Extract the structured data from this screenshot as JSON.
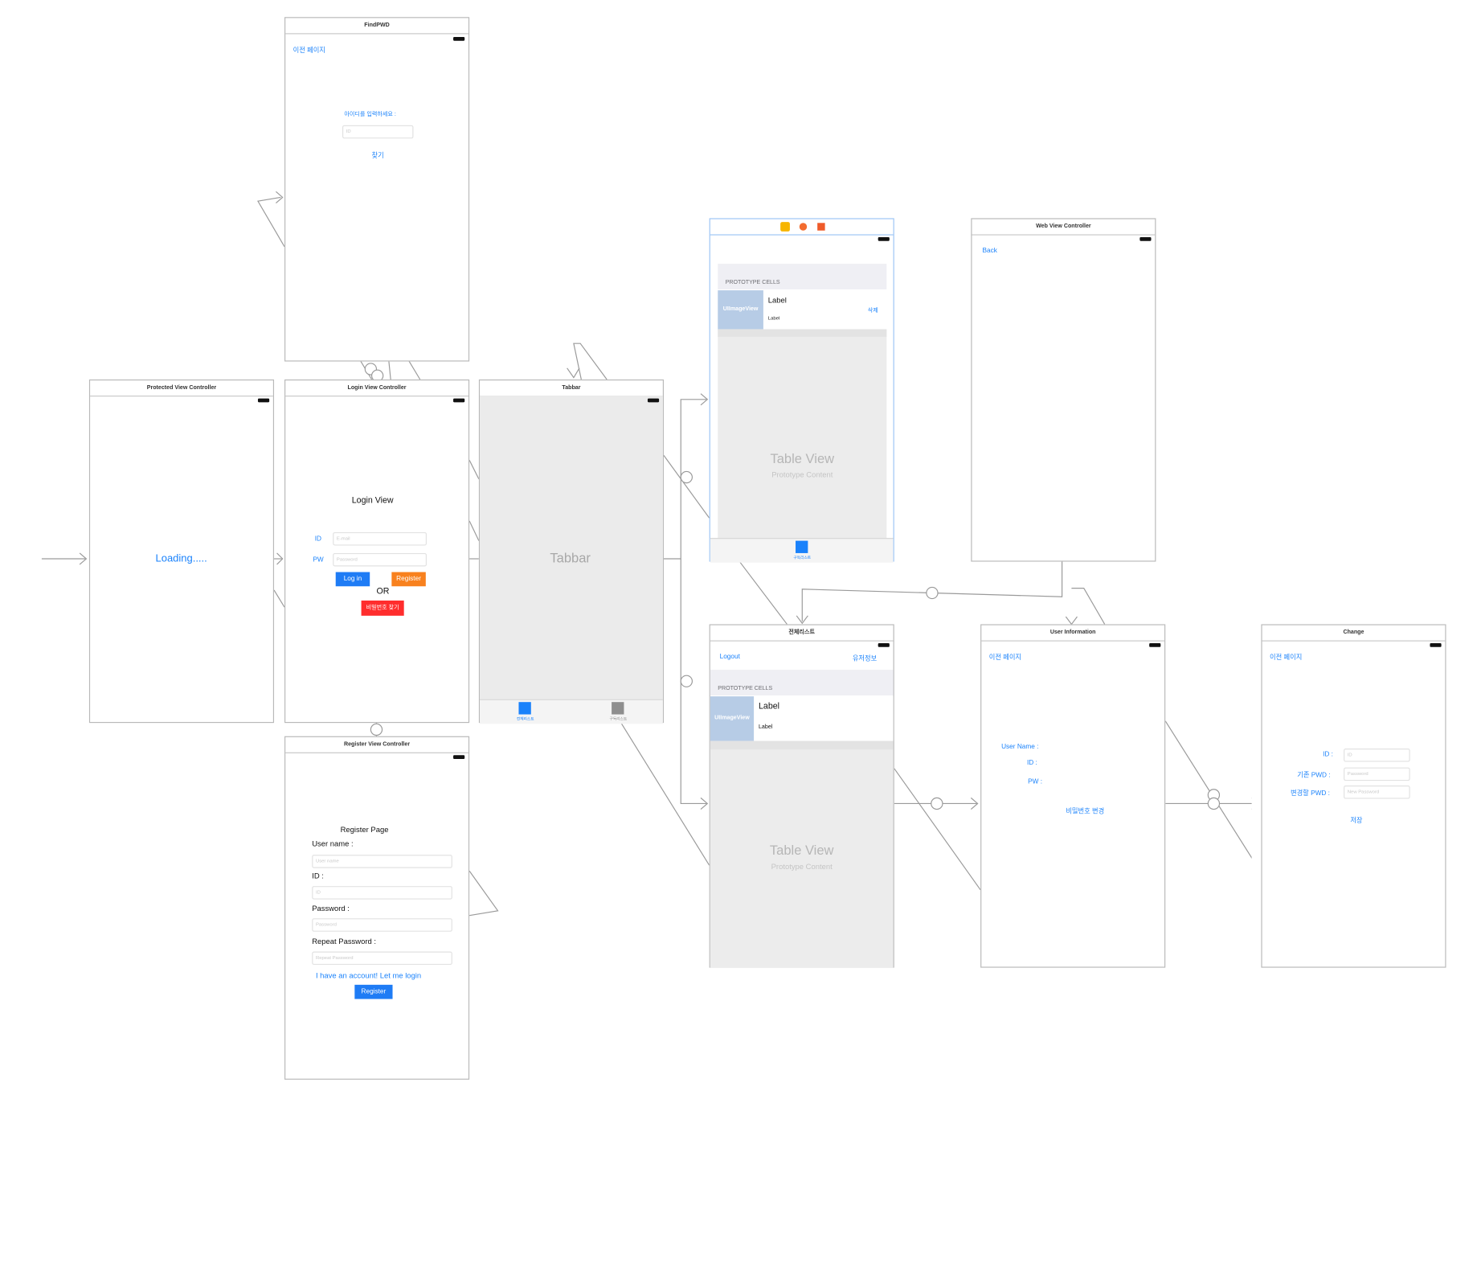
{
  "scenes": {
    "find_pwd": {
      "title": "FindPWD",
      "back": "이전 페이지",
      "prompt": "아이디를 입력하세요 :",
      "id_placeholder": "ID",
      "find_button": "찾기"
    },
    "protected": {
      "title": "Protected View Controller",
      "loading": "Loading....."
    },
    "login": {
      "title": "Login View Controller",
      "heading": "Login View",
      "id_label": "ID",
      "id_placeholder": "E-mail",
      "pw_label": "PW",
      "pw_placeholder": "Password",
      "login_button": "Log in",
      "register_button": "Register",
      "or": "OR",
      "find_pw_button": "비밀번호 찾기"
    },
    "register": {
      "title": "Register View Controller",
      "heading": "Register Page",
      "username_label": "User name :",
      "username_placeholder": "User name",
      "id_label": "ID :",
      "id_placeholder": "ID",
      "password_label": "Password :",
      "password_placeholder": "Password",
      "repeat_label": "Repeat Password :",
      "repeat_placeholder": "Repeat Password",
      "login_link": "I have an account! Let me login",
      "register_button": "Register"
    },
    "tabbar": {
      "title": "Tabbar",
      "center_label": "Tabbar",
      "tab1": "전체리스트",
      "tab2": "구독리스트"
    },
    "sub_table": {
      "prototype_cells": "PROTOTYPE CELLS",
      "image_view": "UIImageView",
      "label_title": "Label",
      "label_sub": "Label",
      "delete": "삭제",
      "table_view": "Table View",
      "prototype_content": "Prototype Content",
      "tab_label": "구독리스트"
    },
    "web_view": {
      "title": "Web View Controller",
      "back": "Back"
    },
    "all_list": {
      "title": "전체리스트",
      "logout": "Logout",
      "user_info": "유저정보",
      "prototype_cells": "PROTOTYPE CELLS",
      "image_view": "UIImageView",
      "label_title": "Label",
      "label_sub": "Label",
      "table_view": "Table View",
      "prototype_content": "Prototype Content"
    },
    "user_info": {
      "title": "User Information",
      "back": "이전 페이지",
      "username_label": "User Name :",
      "id_label": "ID   :",
      "pw_label": "PW :",
      "change_pw": "비밀번호 변경"
    },
    "change": {
      "title": "Change",
      "back": "이전 페이지",
      "id_label": "ID :",
      "id_placeholder": "ID",
      "current_label": "기존 PWD :",
      "current_placeholder": "Password",
      "new_label": "변경할 PWD :",
      "new_placeholder": "New Password",
      "save_button": "저장"
    }
  },
  "colors": {
    "accent": "#1a82fb",
    "login_button": "#1f7cf5",
    "register_button": "#f8811e",
    "find_button": "#ff2d2d",
    "tab_inactive": "#8e8e8e"
  }
}
